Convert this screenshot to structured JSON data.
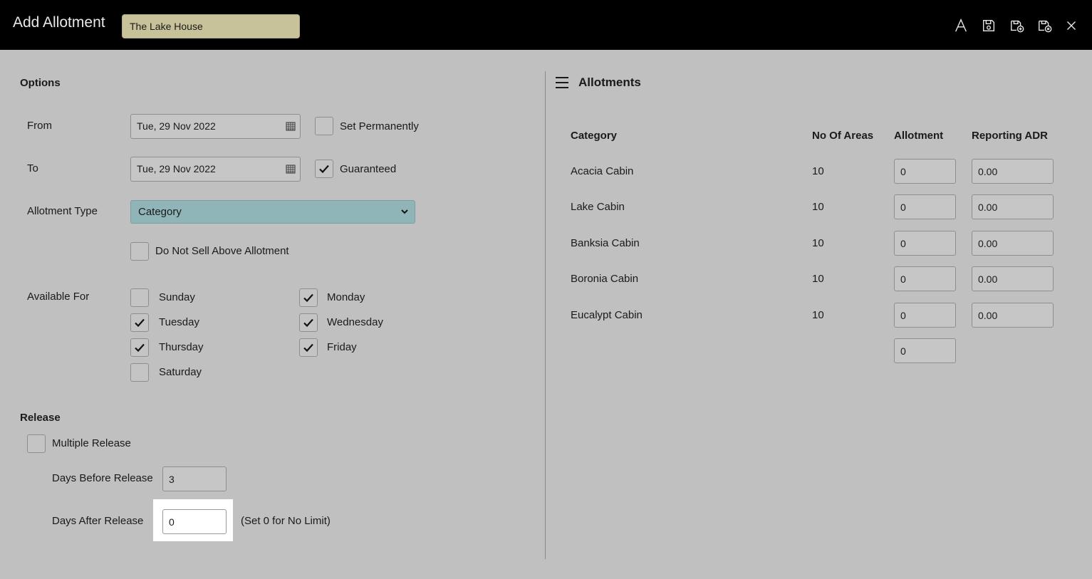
{
  "header": {
    "title": "Add Allotment",
    "property": "The Lake House",
    "icons": [
      "font-icon",
      "save-icon",
      "save-new-icon",
      "save-close-icon",
      "close-icon"
    ]
  },
  "options": {
    "section_label": "Options",
    "from_label": "From",
    "from_value": "Tue, 29 Nov 2022",
    "to_label": "To",
    "to_value": "Tue, 29 Nov 2022",
    "set_permanently_label": "Set Permanently",
    "set_permanently_checked": false,
    "guaranteed_label": "Guaranteed",
    "guaranteed_checked": true,
    "allotment_type_label": "Allotment Type",
    "allotment_type_value": "Category",
    "do_not_sell_label": "Do Not Sell Above Allotment",
    "do_not_sell_checked": false,
    "available_for_label": "Available For",
    "days": [
      {
        "label": "Sunday",
        "checked": false
      },
      {
        "label": "Monday",
        "checked": true
      },
      {
        "label": "Tuesday",
        "checked": true
      },
      {
        "label": "Wednesday",
        "checked": true
      },
      {
        "label": "Thursday",
        "checked": true
      },
      {
        "label": "Friday",
        "checked": true
      },
      {
        "label": "Saturday",
        "checked": false
      }
    ]
  },
  "release": {
    "section_label": "Release",
    "multiple_release_label": "Multiple Release",
    "multiple_release_checked": false,
    "days_before_label": "Days Before Release",
    "days_before_value": "3",
    "days_after_label": "Days After Release",
    "days_after_value": "0",
    "no_limit_note": "(Set 0 for No Limit)"
  },
  "allotments": {
    "title": "Allotments",
    "columns": [
      "Category",
      "No Of Areas",
      "Allotment",
      "Reporting ADR"
    ],
    "rows": [
      {
        "category": "Acacia Cabin",
        "areas": "10",
        "allotment": "0",
        "adr": "0.00"
      },
      {
        "category": "Lake Cabin",
        "areas": "10",
        "allotment": "0",
        "adr": "0.00"
      },
      {
        "category": "Banksia Cabin",
        "areas": "10",
        "allotment": "0",
        "adr": "0.00"
      },
      {
        "category": "Boronia Cabin",
        "areas": "10",
        "allotment": "0",
        "adr": "0.00"
      },
      {
        "category": "Eucalypt Cabin",
        "areas": "10",
        "allotment": "0",
        "adr": "0.00"
      }
    ],
    "total_allotment": "0"
  }
}
